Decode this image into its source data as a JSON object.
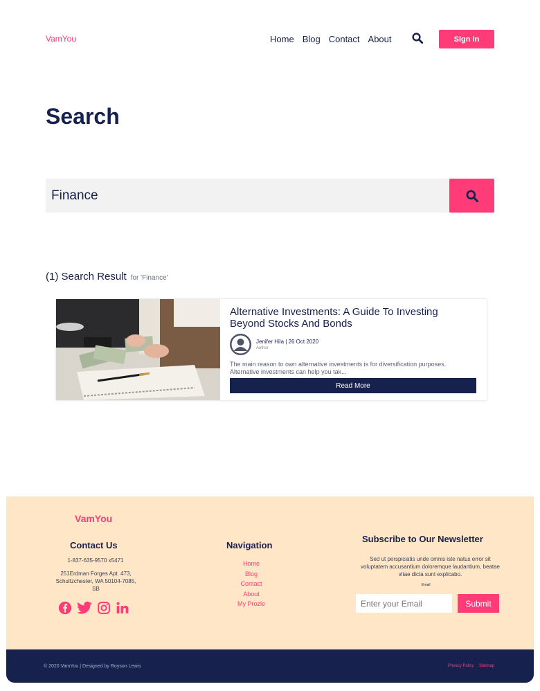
{
  "header": {
    "logo": "VamYou",
    "nav": [
      "Home",
      "Blog",
      "Contact",
      "About"
    ],
    "search_icon": "search-icon",
    "signin_label": "Sign In"
  },
  "page_title": "Search",
  "search": {
    "value": "Finance",
    "button_icon": "search-icon"
  },
  "results": {
    "heading": "(1) Search Result",
    "for_text": "for 'Finance'"
  },
  "card": {
    "title": "Alternative Investments: A Guide To Investing Beyond Stocks And Bonds",
    "author_line": "Jenifer Hila | 26 Oct 2020",
    "author_role": "Author",
    "excerpt": "The main reason to own alternative investments is for diversification purposes. Alternative investments can help you tak...",
    "read_more": "Read More"
  },
  "footer": {
    "logo": "VamYou",
    "contact": {
      "title": "Contact Us",
      "phone": "1-837-635-9570 x5471",
      "address": "251Erdman Forges Apt. 473, Schultzchester, WA 50104-7085, SB"
    },
    "navigation": {
      "title": "Navigation",
      "links": [
        "Home",
        "Blog",
        "Contact",
        "About",
        "My Prozle"
      ]
    },
    "newsletter": {
      "title": "Subscribe to Our Newsletter",
      "text": "Sed ut perspiciatis unde omnis iste natus error sit voluptatem accusantium doloremque laudantium, beatae vitae dicta sunt explicabo.",
      "email_label": "Email",
      "email_placeholder": "Enter your Email",
      "submit_label": "Submit"
    },
    "social_icons": [
      "facebook-icon",
      "twitter-icon",
      "instagram-icon",
      "linkedin-icon"
    ],
    "copyright": "© 2020 VamYou | Designed by Royson Lewis",
    "legal": [
      "Privacy Policy",
      "Sitemap"
    ]
  },
  "colors": {
    "accent": "#ff3c78",
    "navy": "#17214d",
    "footer_bg": "#ffe6c7"
  }
}
